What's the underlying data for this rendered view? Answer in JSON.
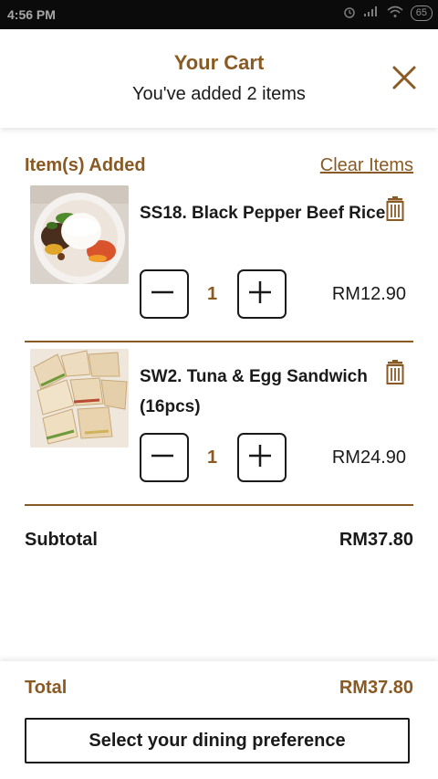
{
  "status_bar": {
    "time": "4:56 PM",
    "battery": "65"
  },
  "header": {
    "title": "Your Cart",
    "subtitle": "You've added 2 items"
  },
  "items_section": {
    "label": "Item(s) Added",
    "clear_label": "Clear Items"
  },
  "items": [
    {
      "name": "SS18. Black Pepper Beef Rice",
      "quantity": "1",
      "price": "RM12.90"
    },
    {
      "name": "SW2. Tuna & Egg Sandwich (16pcs)",
      "quantity": "1",
      "price": "RM24.90"
    }
  ],
  "subtotal": {
    "label": "Subtotal",
    "value": "RM37.80"
  },
  "footer": {
    "total_label": "Total",
    "total_value": "RM37.80",
    "cta_label": "Select your dining preference"
  },
  "colors": {
    "accent": "#8a5a24",
    "text": "#1a1a1a",
    "status_bar": "#0b0b0b"
  }
}
